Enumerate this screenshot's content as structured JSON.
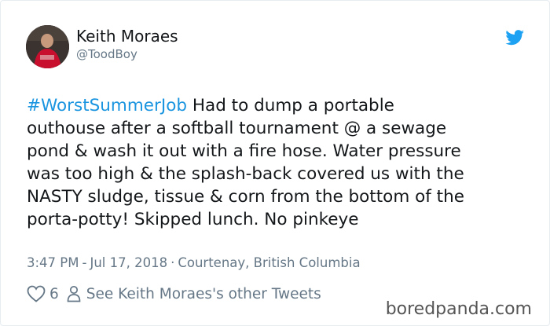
{
  "author": {
    "display_name": "Keith Moraes",
    "handle": "@ToodBoy"
  },
  "tweet": {
    "hashtag": "#WorstSummerJob",
    "lines": [
      " Had to dump a portable",
      "outhouse after a softball tournament @ a sewage",
      "pond & wash it out with a fire hose. Water pressure",
      "was too high & the splash-back covered us with the",
      "NASTY sludge, tissue & corn from the bottom of the",
      "porta-potty! Skipped lunch. No pinkeye"
    ]
  },
  "meta": {
    "time": "3:47 PM",
    "date": "Jul 17, 2018",
    "location": "Courtenay, British Columbia"
  },
  "actions": {
    "like_count": "6",
    "other_tweets_label": "See Keith Moraes's other Tweets"
  },
  "watermark": "boredpanda.com",
  "icons": {
    "brand": "twitter-bird-icon",
    "like": "heart-icon",
    "profile": "person-icon"
  },
  "colors": {
    "link_blue": "#1b95e0",
    "twitter_blue": "#1da1f2",
    "secondary_text": "#657786",
    "primary_text": "#14171a",
    "avatar_shirt": "#c8102e"
  }
}
